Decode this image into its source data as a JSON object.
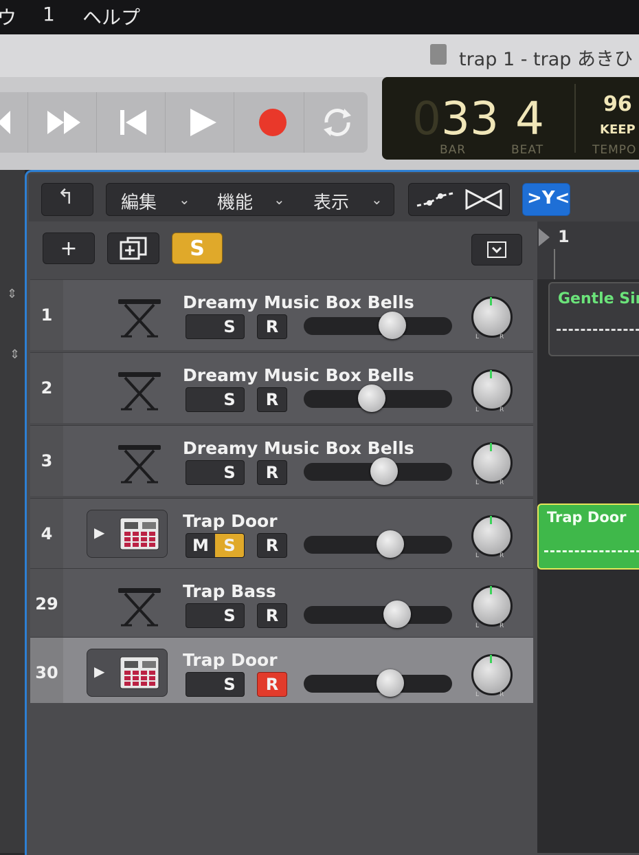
{
  "menubar": {
    "items": [
      "ウ",
      "1",
      "ヘルプ"
    ]
  },
  "window": {
    "title": "trap 1 - trap あきひ"
  },
  "lcd": {
    "bar": "33",
    "bar_prefix": "0",
    "beat": "4",
    "tempo": "96",
    "keep": "KEEP",
    "bar_label": "BAR",
    "beat_label": "BEAT",
    "tempo_label": "TEMPO"
  },
  "toolbar": {
    "menu_edit": "編集",
    "menu_function": "機能",
    "menu_view": "表示"
  },
  "header": {
    "add_label": "+",
    "solo_label": "S"
  },
  "ruler": {
    "bar1": "1"
  },
  "tracks": [
    {
      "number": "1",
      "name": "Dreamy Music Box Bells",
      "instrument": "keyboard-stand-icon",
      "mute": "",
      "solo": "S",
      "record": "R",
      "volume": 0.62,
      "solo_active": false,
      "record_active": false,
      "selected": false
    },
    {
      "number": "2",
      "name": "Dreamy Music Box Bells",
      "instrument": "keyboard-stand-icon",
      "mute": "",
      "solo": "S",
      "record": "R",
      "volume": 0.45,
      "solo_active": false,
      "record_active": false,
      "selected": false
    },
    {
      "number": "3",
      "name": "Dreamy Music Box Bells",
      "instrument": "keyboard-stand-icon",
      "mute": "",
      "solo": "S",
      "record": "R",
      "volume": 0.55,
      "solo_active": false,
      "record_active": false,
      "selected": false
    },
    {
      "number": "4",
      "name": "Trap Door",
      "instrument": "drum-machine-icon",
      "mute": "M",
      "solo": "S",
      "record": "R",
      "volume": 0.6,
      "solo_active": true,
      "record_active": false,
      "selected": false
    },
    {
      "number": "29",
      "name": "Trap Bass",
      "instrument": "keyboard-stand-icon",
      "mute": "",
      "solo": "S",
      "record": "R",
      "volume": 0.66,
      "solo_active": false,
      "record_active": false,
      "selected": false
    },
    {
      "number": "30",
      "name": "Trap Door",
      "instrument": "drum-machine-icon",
      "mute": "",
      "solo": "S",
      "record": "R",
      "volume": 0.6,
      "solo_active": false,
      "record_active": true,
      "selected": true
    }
  ],
  "regions": [
    {
      "name": "Gentle Sin",
      "color": "#3a3a3d",
      "text_color": "#6be37a"
    },
    {
      "name": "Trap Door",
      "color": "#3fb84a",
      "text_color": "#f2fff2"
    }
  ],
  "colors": {
    "accent": "#2d7fd3",
    "record": "#e23b2b",
    "solo": "#e0a92a"
  }
}
